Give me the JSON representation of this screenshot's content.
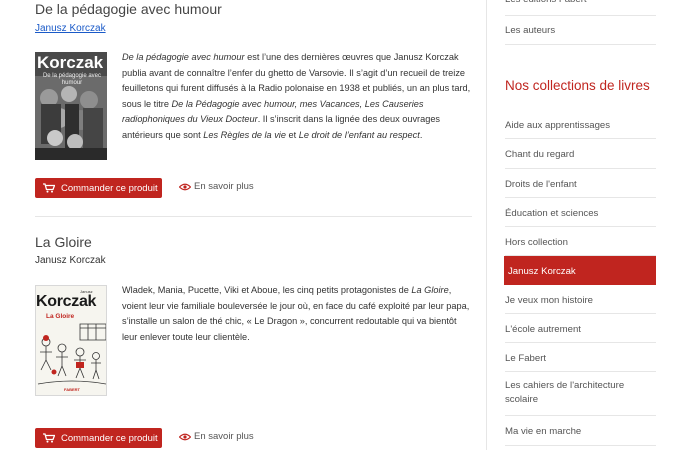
{
  "products": [
    {
      "title": "De la pédagogie avec humour",
      "author": "Janusz Korczak",
      "cover": {
        "brand": "Korczak",
        "subtitle": "De la pédagogie avec humour"
      },
      "desc_parts": [
        {
          "t": "De la pédagogie avec humour",
          "i": true
        },
        {
          "t": " est l’une des dernières œuvres que Janusz Korczak publia avant de connaître l’enfer du ghetto de Varsovie. Il s’agit d’un recueil de treize feuilletons qui furent diffusés à la Radio polonaise en 1938 et publiés, un an plus tard, sous le titre ",
          "i": false
        },
        {
          "t": "De la Pédagogie avec humour, mes Vacances, Les Causeries radiophoniques du Vieux Docteur",
          "i": true
        },
        {
          "t": ". Il s’inscrit dans la lignée des deux ouvrages antérieurs que sont ",
          "i": false
        },
        {
          "t": "Les Règles de la vie",
          "i": true
        },
        {
          "t": " et ",
          "i": false
        },
        {
          "t": "Le droit de l’enfant au respect",
          "i": true
        },
        {
          "t": ".",
          "i": false
        }
      ],
      "order_label": "Commander ce produit",
      "more_label": "En savoir plus"
    },
    {
      "title": "La Gloire",
      "author": "Janusz Korczak",
      "cover": {
        "brand": "Korczak",
        "subtitle": "La Gloire",
        "small": "Janusz",
        "publisher": "FABERT"
      },
      "desc_parts": [
        {
          "t": "Wladek, Mania, Pucette, Viki et Aboue, les cinq petits protagonistes de ",
          "i": false
        },
        {
          "t": "La Gloire",
          "i": true
        },
        {
          "t": ", voient leur vie familiale bouleversée le jour où, en face du café exploité par leur papa, s’installe un salon de thé chic, « Le Dragon », concurrent redoutable qui va bientôt leur enlever toute leur clientèle.",
          "i": false
        }
      ],
      "order_label": "Commander ce produit",
      "more_label": "En savoir plus"
    }
  ],
  "sidebar": {
    "top_items": [
      {
        "label": "Les éditions Fabert"
      },
      {
        "label": "Les auteurs"
      }
    ],
    "section_title": "Nos collections de livres",
    "items": [
      {
        "label": "Aide aux apprentissages",
        "active": false
      },
      {
        "label": "Chant du regard",
        "active": false
      },
      {
        "label": "Droits de l'enfant",
        "active": false
      },
      {
        "label": "Éducation et sciences",
        "active": false
      },
      {
        "label": "Hors collection",
        "active": false
      },
      {
        "label": "Janusz Korczak",
        "active": true
      },
      {
        "label": "Je veux mon histoire",
        "active": false
      },
      {
        "label": "L'école autrement",
        "active": false
      },
      {
        "label": "Le Fabert",
        "active": false
      },
      {
        "label": "Les cahiers de l'architecture scolaire",
        "active": false
      },
      {
        "label": "Ma vie en marche",
        "active": false
      }
    ]
  },
  "colors": {
    "accent": "#c0251f",
    "link": "#1a5ac8",
    "divider": "#e6e6e6"
  },
  "icons": {
    "order": "cart-icon",
    "more": "eye-icon"
  }
}
